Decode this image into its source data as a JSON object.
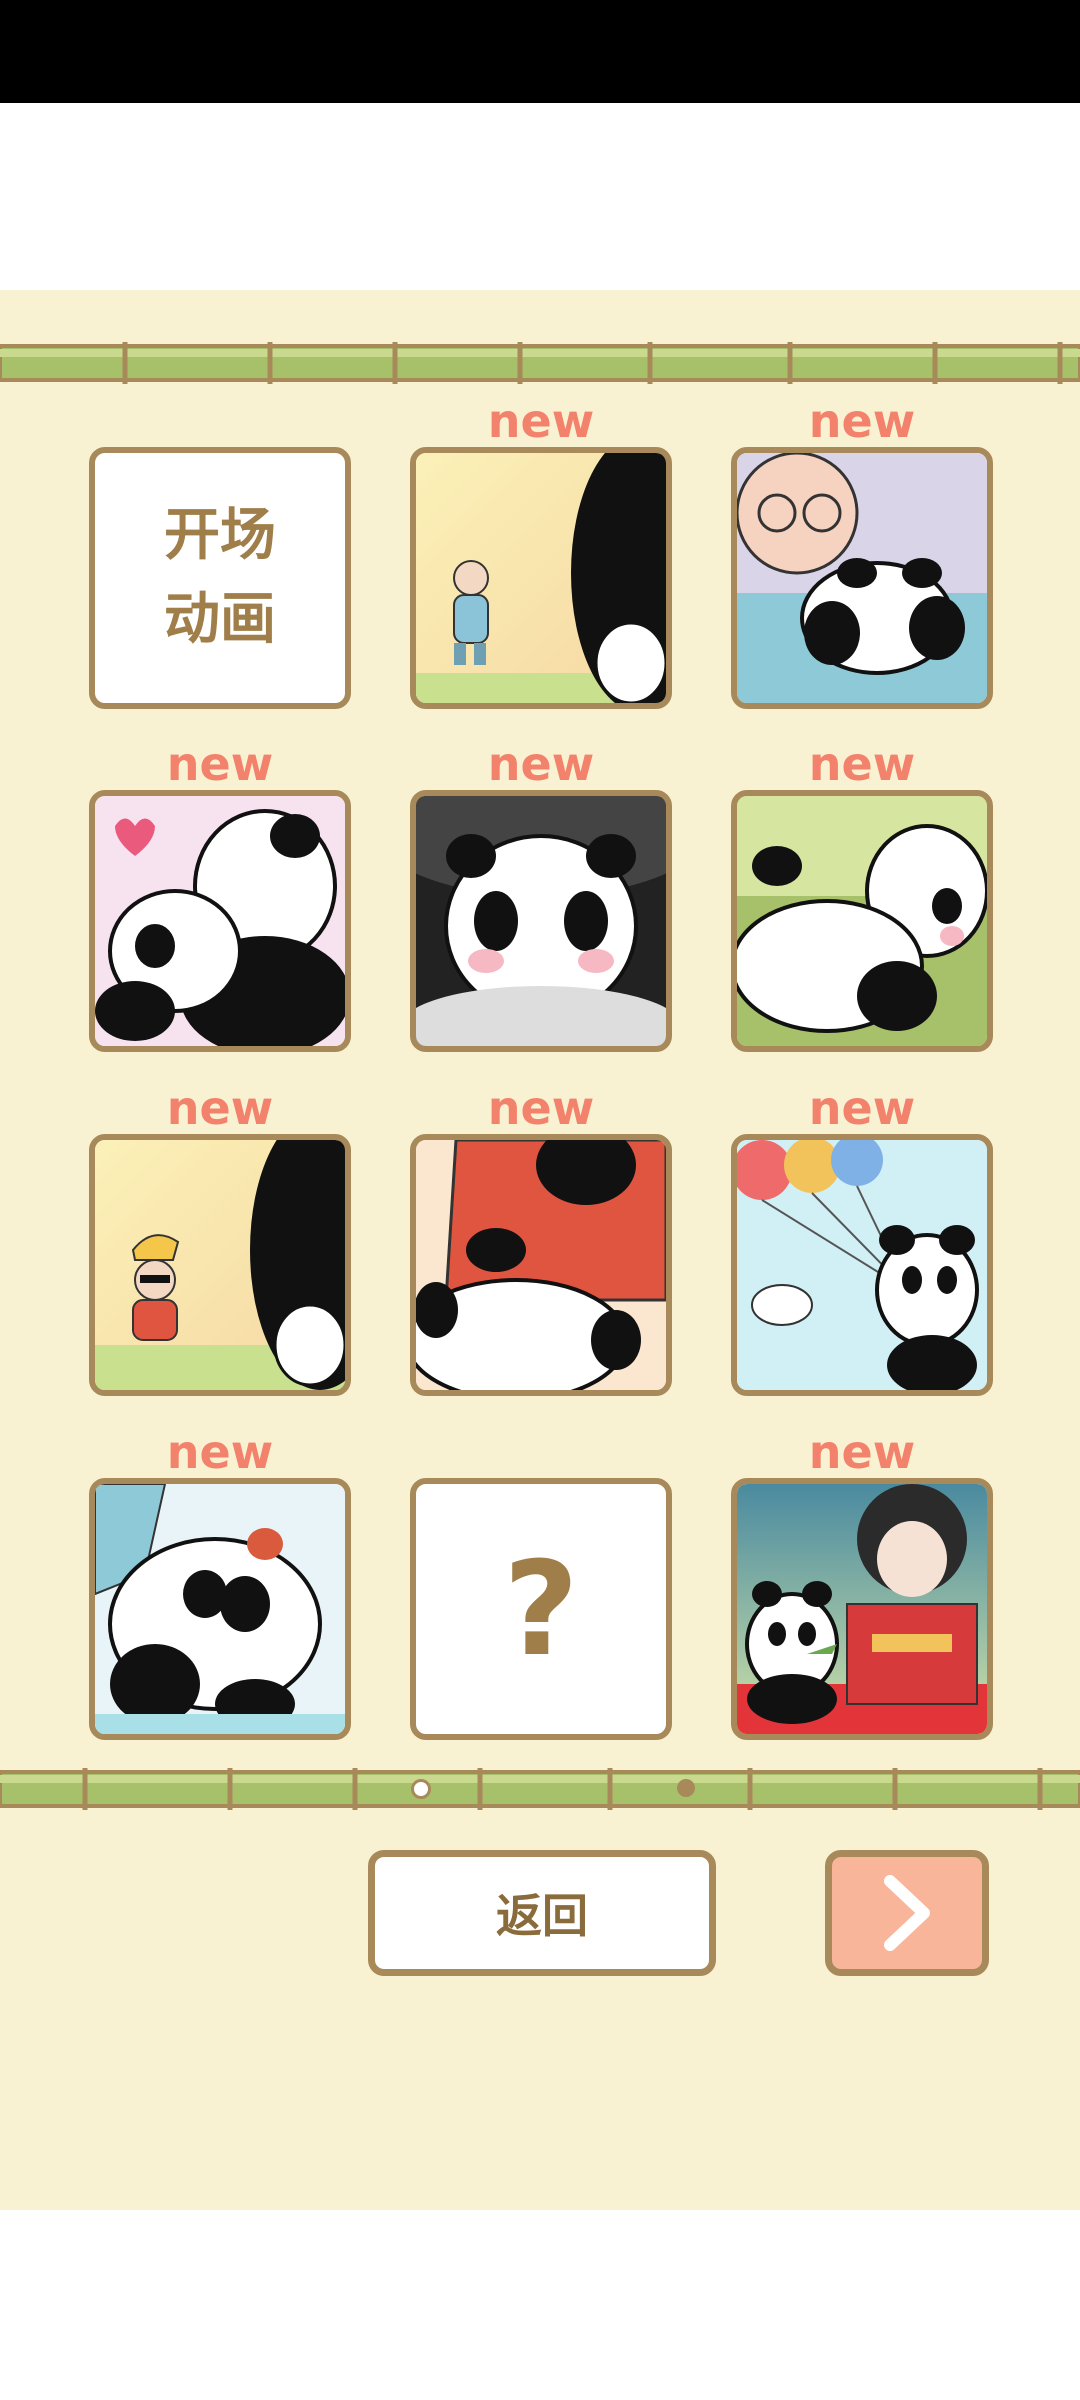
{
  "gallery": {
    "cells": [
      {
        "new": "",
        "text": "开场\n动画"
      },
      {
        "new": "new",
        "text": ""
      },
      {
        "new": "new",
        "text": ""
      },
      {
        "new": "new",
        "text": ""
      },
      {
        "new": "new",
        "text": ""
      },
      {
        "new": "new",
        "text": ""
      },
      {
        "new": "new",
        "text": ""
      },
      {
        "new": "new",
        "text": ""
      },
      {
        "new": "new",
        "text": ""
      },
      {
        "new": "new",
        "text": ""
      },
      {
        "new": "",
        "text": "?"
      },
      {
        "new": "new",
        "text": ""
      }
    ]
  },
  "pager": {
    "current_page": 1,
    "total_pages": 2
  },
  "footer": {
    "back_label": "返回",
    "next_icon": "chevron-right-icon"
  },
  "colors": {
    "background": "#f8f1d2",
    "frame": "#a88a5a",
    "new_tag": "#f2826c",
    "next_button": "#f8b59a",
    "bamboo": "#a7c06a"
  }
}
